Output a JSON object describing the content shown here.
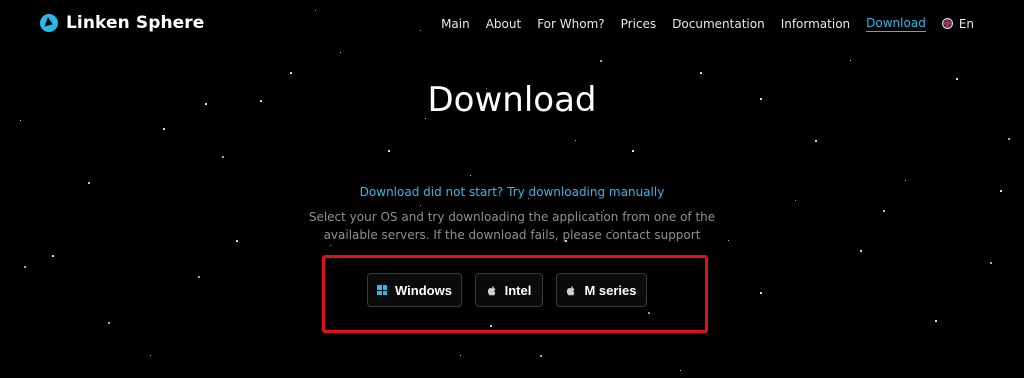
{
  "brand": {
    "name": "Linken Sphere"
  },
  "nav": {
    "items": [
      "Main",
      "About",
      "For Whom?",
      "Prices",
      "Documentation",
      "Information",
      "Download"
    ],
    "active": "Download",
    "language": "En"
  },
  "page": {
    "title": "Download",
    "retry_link": "Download did not start? Try downloading manually",
    "description": "Select your OS and try downloading the application from one of the available servers. If the download fails, please contact support"
  },
  "downloads": {
    "windows_label": "Windows",
    "intel_label": "Intel",
    "m_series_label": "M series"
  },
  "colors": {
    "accent": "#2ab7ea",
    "highlight": "#e0101a",
    "background": "#000000"
  },
  "icons": {
    "logo": "linken-sphere-logo-icon",
    "language": "uk-flag-icon",
    "windows": "windows-icon",
    "apple": "apple-icon"
  }
}
